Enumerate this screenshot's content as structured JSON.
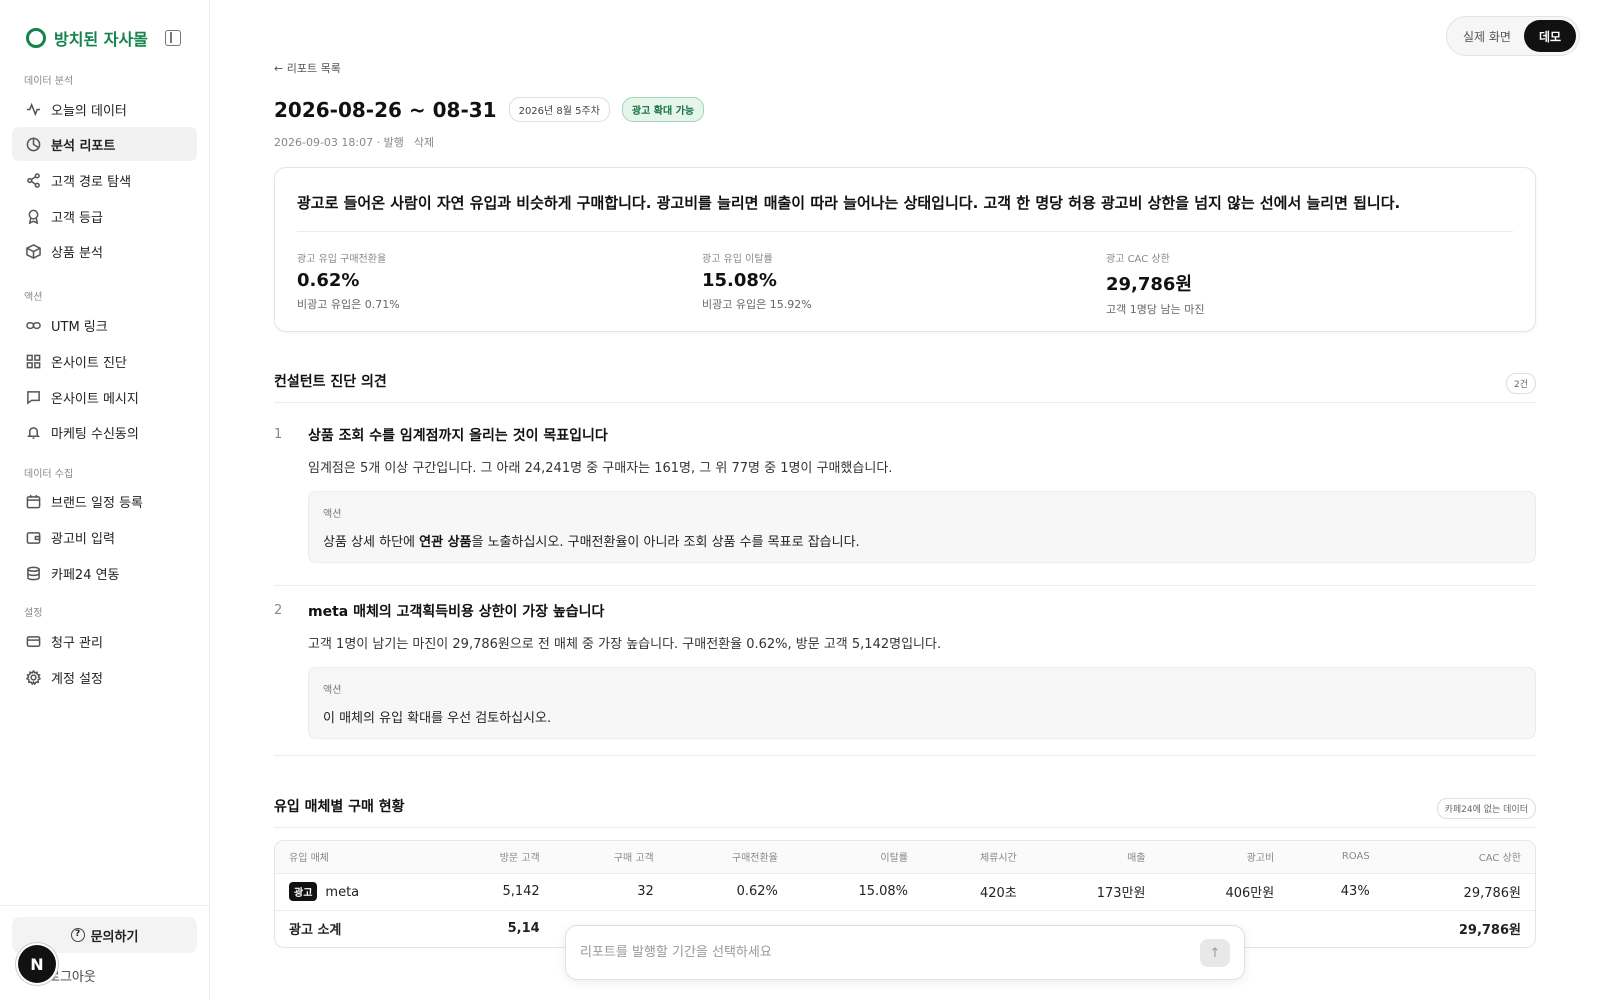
{
  "brand": {
    "name": "방치된 자사몰",
    "accent": "#14824b"
  },
  "sidebar": {
    "sections": [
      {
        "label": "데이터 분석",
        "items": [
          {
            "label": "오늘의 데이터",
            "icon": "activity-icon"
          },
          {
            "label": "분석 리포트",
            "icon": "pie-chart-icon",
            "active": true
          },
          {
            "label": "고객 경로 탐색",
            "icon": "share-icon"
          },
          {
            "label": "고객 등급",
            "icon": "award-icon"
          },
          {
            "label": "상품 분석",
            "icon": "box-icon"
          }
        ]
      },
      {
        "label": "액션",
        "items": [
          {
            "label": "UTM 링크",
            "icon": "link-icon"
          },
          {
            "label": "온사이트 진단",
            "icon": "grid-icon"
          },
          {
            "label": "온사이트 메시지",
            "icon": "message-icon"
          },
          {
            "label": "마케팅 수신동의",
            "icon": "bell-icon"
          }
        ]
      },
      {
        "label": "데이터 수집",
        "items": [
          {
            "label": "브랜드 일정 등록",
            "icon": "calendar-icon"
          },
          {
            "label": "광고비 입력",
            "icon": "wallet-icon"
          },
          {
            "label": "카페24 연동",
            "icon": "database-icon"
          }
        ]
      },
      {
        "label": "설정",
        "items": [
          {
            "label": "청구 관리",
            "icon": "credit-card-icon"
          },
          {
            "label": "계정 설정",
            "icon": "gear-icon"
          }
        ]
      }
    ],
    "help_label": "문의하기",
    "logout_label": "로그아웃",
    "avatar_letter": "N"
  },
  "mode_toggle": {
    "real": "실제 화면",
    "demo": "데모",
    "selected": "데모"
  },
  "report": {
    "back_label": "← 리포트 목록",
    "title": "2026-08-26 ~ 08-31",
    "week_label": "2026년 8월 5주차",
    "status_label": "광고 확대 가능",
    "published": "2026-09-03 18:07 · 발행",
    "delete_label": "삭제"
  },
  "summary": {
    "headline": "광고로 들어온 사람이 자연 유입과 비슷하게 구매합니다. 광고비를 늘리면 매출이 따라 늘어나는 상태입니다. 고객 한 명당 허용 광고비 상한을 넘지 않는 선에서 늘리면 됩니다.",
    "metrics": [
      {
        "label": "광고 유입 구매전환율",
        "value": "0.62%",
        "sub": "비광고 유입은 0.71%"
      },
      {
        "label": "광고 유입 이탈률",
        "value": "15.08%",
        "sub": "비광고 유입은 15.92%"
      },
      {
        "label": "광고 CAC 상한",
        "value": "29,786원",
        "sub": "고객 1명당 남는 마진"
      }
    ]
  },
  "opinions": {
    "title": "컨설턴트 진단 의견",
    "count": "2건",
    "items": [
      {
        "num": "1",
        "title": "상품 조회 수를 임계점까지 올리는 것이 목표입니다",
        "body": "임계점은 5개 이상 구간입니다. 그 아래 24,241명 중 구매자는 161명, 그 위 77명 중 1명이 구매했습니다.",
        "action_label": "액션",
        "action_pre": "상품 상세 하단에 ",
        "action_bold": "연관 상품",
        "action_post": "을 노출하십시오. 구매전환율이 아니라 조회 상품 수를 목표로 잡습니다."
      },
      {
        "num": "2",
        "title": "meta 매체의 고객획득비용 상한이 가장 높습니다",
        "body": "고객 1명이 남기는 마진이 29,786원으로 전 매체 중 가장 높습니다. 구매전환율 0.62%, 방문 고객 5,142명입니다.",
        "action_label": "액션",
        "action_pre": "이 매체의 유입 확대를 우선 검토하십시오.",
        "action_bold": "",
        "action_post": ""
      }
    ]
  },
  "channels": {
    "title": "유입 매체별 구매 현황",
    "badge": "카페24에 없는 데이터",
    "columns": [
      "유입 매체",
      "방문 고객",
      "구매 고객",
      "구매전환율",
      "이탈률",
      "체류시간",
      "매출",
      "광고비",
      "ROAS",
      "CAC 상한"
    ],
    "rows": [
      {
        "tag": "광고",
        "channel": "meta",
        "visitors": "5,142",
        "buyers": "32",
        "cvr": "0.62%",
        "bounce": "15.08%",
        "dwell": "420초",
        "revenue": "173만원",
        "ad_spend": "406만원",
        "roas": "43%",
        "cac": "29,786원"
      }
    ],
    "subtotal": {
      "label": "광고 소계",
      "visitors": "5,14",
      "cac": "29,786원"
    }
  },
  "prompt": {
    "placeholder": "리포트를 발행할 기간을 선택하세요",
    "send_icon": "arrow-up-icon"
  }
}
